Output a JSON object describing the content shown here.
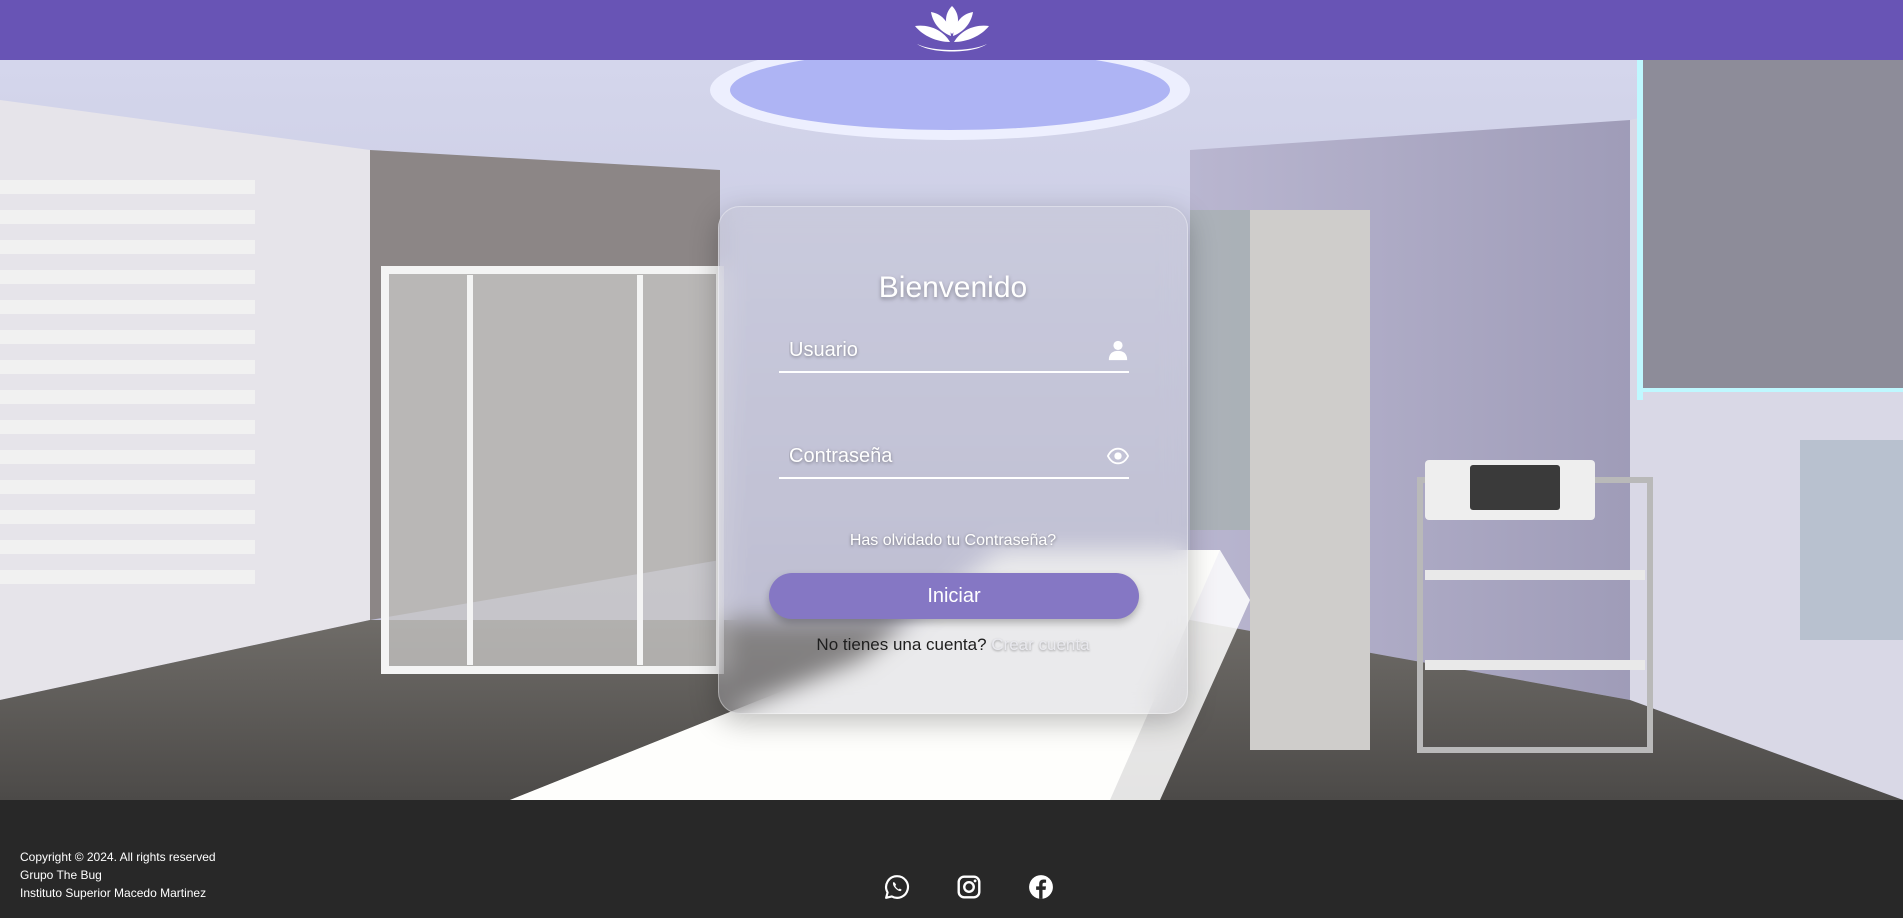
{
  "header": {
    "logo": "lotus-icon",
    "background_color": "#6854b5"
  },
  "login": {
    "title": "Bienvenido",
    "username": {
      "value": "",
      "placeholder": "Usuario",
      "icon": "user-icon"
    },
    "password": {
      "value": "",
      "placeholder": "Contraseña",
      "icon": "eye-icon"
    },
    "forgot_link": "Has olvidado tu Contraseña?",
    "submit_label": "Iniciar",
    "submit_color": "#8577c4",
    "signup_prompt": "No tienes una cuenta?",
    "signup_link": "Crear cuenta"
  },
  "footer": {
    "copyright": "Copyright © 2024. All rights reserved",
    "group": "Grupo The Bug",
    "institute": "Instituto Superior Macedo Martinez",
    "social_icons": [
      "whatsapp-icon",
      "instagram-icon",
      "facebook-icon"
    ],
    "background_color": "#282828"
  }
}
